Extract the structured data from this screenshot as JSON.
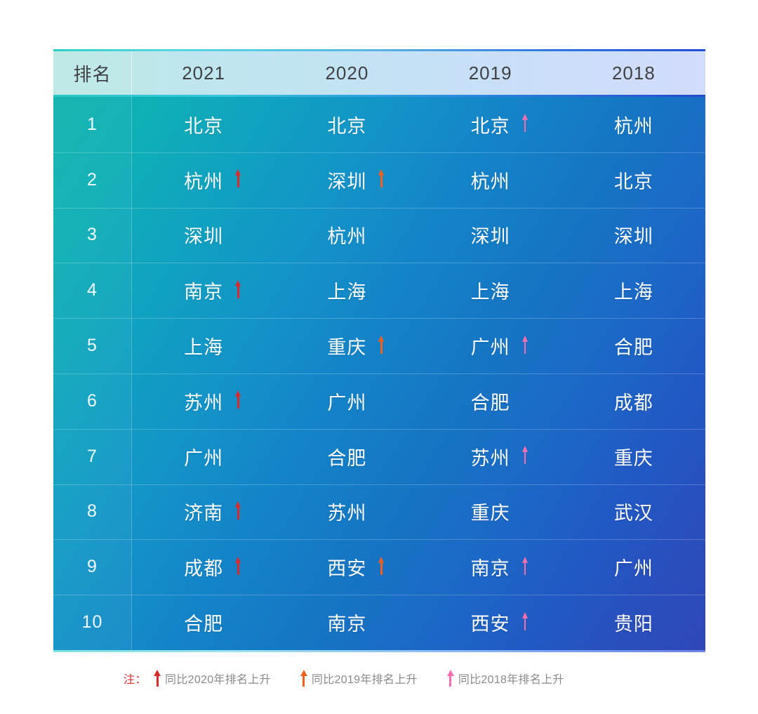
{
  "table": {
    "columns": [
      {
        "key": "rank",
        "label": "排名"
      },
      {
        "key": "y2021",
        "label": "2021"
      },
      {
        "key": "y2020",
        "label": "2020"
      },
      {
        "key": "y2019",
        "label": "2019"
      },
      {
        "key": "y2018",
        "label": "2018"
      }
    ],
    "arrow_colors": {
      "y2021": "#d92b2b",
      "y2020": "#f2601f",
      "y2019": "#f56fae",
      "y2018": "#f56fae"
    },
    "rows": [
      {
        "rank": "1",
        "y2021": {
          "city": "北京",
          "up": false
        },
        "y2020": {
          "city": "北京",
          "up": false
        },
        "y2019": {
          "city": "北京",
          "up": true
        },
        "y2018": {
          "city": "杭州",
          "up": false
        }
      },
      {
        "rank": "2",
        "y2021": {
          "city": "杭州",
          "up": true
        },
        "y2020": {
          "city": "深圳",
          "up": true
        },
        "y2019": {
          "city": "杭州",
          "up": false
        },
        "y2018": {
          "city": "北京",
          "up": false
        }
      },
      {
        "rank": "3",
        "y2021": {
          "city": "深圳",
          "up": false
        },
        "y2020": {
          "city": "杭州",
          "up": false
        },
        "y2019": {
          "city": "深圳",
          "up": false
        },
        "y2018": {
          "city": "深圳",
          "up": false
        }
      },
      {
        "rank": "4",
        "y2021": {
          "city": "南京",
          "up": true
        },
        "y2020": {
          "city": "上海",
          "up": false
        },
        "y2019": {
          "city": "上海",
          "up": false
        },
        "y2018": {
          "city": "上海",
          "up": false
        }
      },
      {
        "rank": "5",
        "y2021": {
          "city": "上海",
          "up": false
        },
        "y2020": {
          "city": "重庆",
          "up": true
        },
        "y2019": {
          "city": "广州",
          "up": true
        },
        "y2018": {
          "city": "合肥",
          "up": false
        }
      },
      {
        "rank": "6",
        "y2021": {
          "city": "苏州",
          "up": true
        },
        "y2020": {
          "city": "广州",
          "up": false
        },
        "y2019": {
          "city": "合肥",
          "up": false
        },
        "y2018": {
          "city": "成都",
          "up": false
        }
      },
      {
        "rank": "7",
        "y2021": {
          "city": "广州",
          "up": false
        },
        "y2020": {
          "city": "合肥",
          "up": false
        },
        "y2019": {
          "city": "苏州",
          "up": true
        },
        "y2018": {
          "city": "重庆",
          "up": false
        }
      },
      {
        "rank": "8",
        "y2021": {
          "city": "济南",
          "up": true
        },
        "y2020": {
          "city": "苏州",
          "up": false
        },
        "y2019": {
          "city": "重庆",
          "up": false
        },
        "y2018": {
          "city": "武汉",
          "up": false
        }
      },
      {
        "rank": "9",
        "y2021": {
          "city": "成都",
          "up": true
        },
        "y2020": {
          "city": "西安",
          "up": true
        },
        "y2019": {
          "city": "南京",
          "up": true
        },
        "y2018": {
          "city": "广州",
          "up": false
        }
      },
      {
        "rank": "10",
        "y2021": {
          "city": "合肥",
          "up": false
        },
        "y2020": {
          "city": "南京",
          "up": false
        },
        "y2019": {
          "city": "西安",
          "up": true
        },
        "y2018": {
          "city": "贵阳",
          "up": false
        }
      }
    ]
  },
  "legend": {
    "note_label": "注：",
    "note_color": "#e03030",
    "items": [
      {
        "text": "同比2020年排名上升",
        "color": "#d92b2b"
      },
      {
        "text": "同比2019年排名上升",
        "color": "#f2601f"
      },
      {
        "text": "同比2018年排名上升",
        "color": "#f56fae"
      }
    ]
  }
}
